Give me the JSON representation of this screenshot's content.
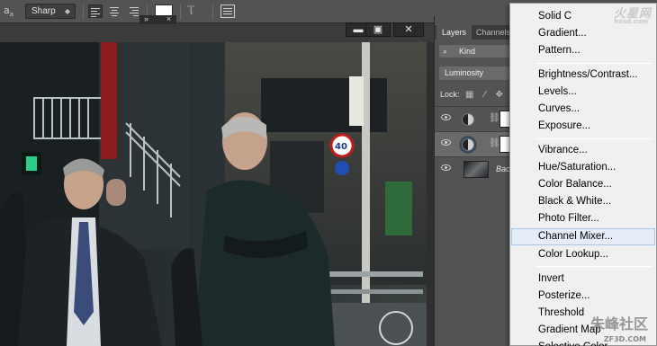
{
  "options_bar": {
    "aa_icon_text": "a",
    "aa_icon_sub": "a",
    "anti_alias": "Sharp",
    "text_color": "#ffffff"
  },
  "mini_panel": {
    "collapse_glyph": "»",
    "close_glyph": "×"
  },
  "window_controls": {
    "minimize": "▬",
    "maximize": "▣",
    "close": "✕"
  },
  "layers_panel": {
    "tabs": [
      "Layers",
      "Channels"
    ],
    "filter_kind": "Kind",
    "blend_mode": "Luminosity",
    "lock_label": "Lock:",
    "layers": [
      {
        "type": "adjustment",
        "visible": true,
        "selected": false
      },
      {
        "type": "adjustment",
        "visible": true,
        "selected": true
      },
      {
        "type": "background",
        "visible": true,
        "name": "Bac"
      }
    ]
  },
  "adjustment_menu": {
    "groups": [
      [
        "Solid C",
        "Gradient...",
        "Pattern..."
      ],
      [
        "Brightness/Contrast...",
        "Levels...",
        "Curves...",
        "Exposure..."
      ],
      [
        "Vibrance...",
        "Hue/Saturation...",
        "Color Balance...",
        "Black & White...",
        "Photo Filter...",
        "Channel Mixer...",
        "Color Lookup..."
      ],
      [
        "Invert",
        "Posterize...",
        "Threshold",
        "Gradient Map",
        "Selective Color..."
      ]
    ],
    "highlighted": "Channel Mixer..."
  },
  "watermarks": {
    "top": "火星网",
    "top_sub": "hxsd.com",
    "bottom": "朱峰社区",
    "bottom_sub": "ZF3D.COM"
  },
  "colors": {
    "ui_dark": "#535353",
    "menu_bg": "#f0f0f0",
    "menu_highlight": "#e5eef8"
  }
}
